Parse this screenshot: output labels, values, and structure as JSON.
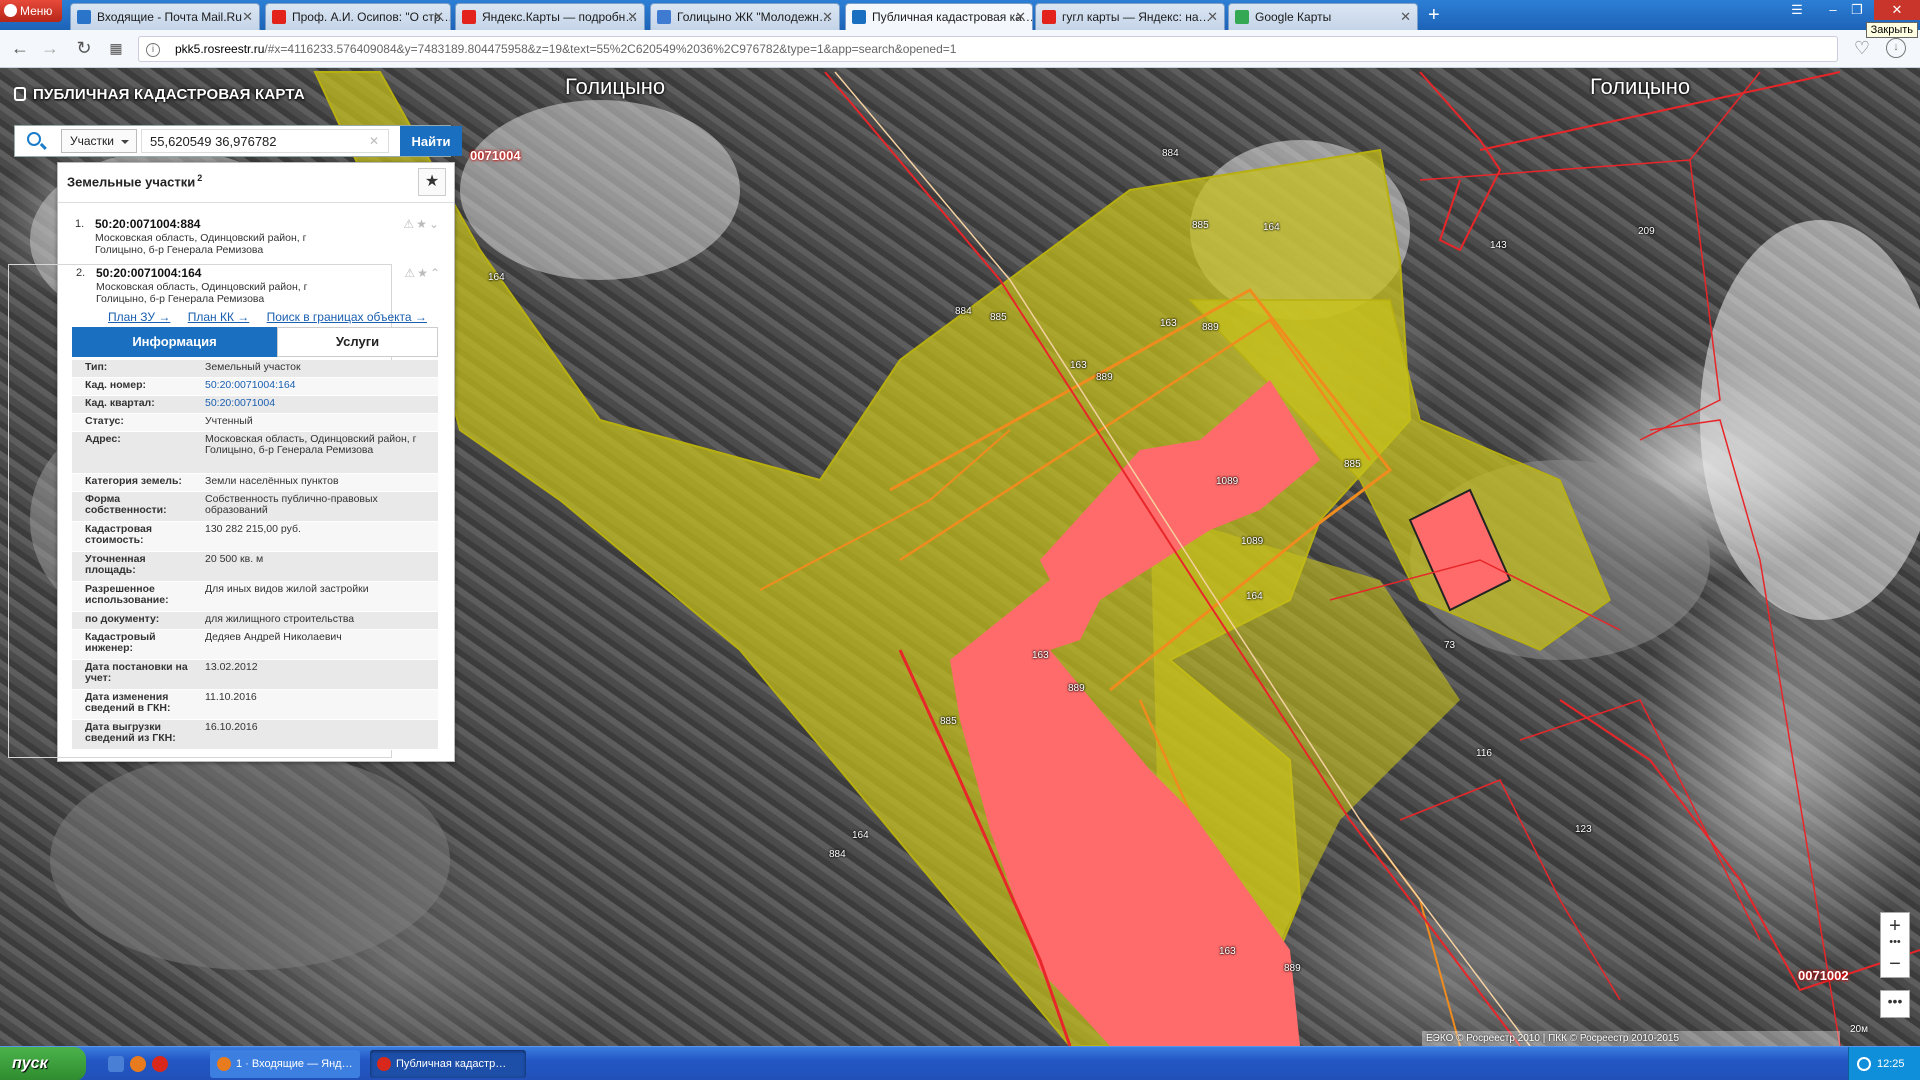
{
  "browser": {
    "menu_label": "Меню",
    "tabs": [
      {
        "label": "Входящие - Почта Mail.Ru",
        "color": "#2a75c9"
      },
      {
        "label": "Проф. А.И. Осипов: \"О стр…",
        "color": "#e3231b"
      },
      {
        "label": "Яндекс.Карты — подробн…",
        "color": "#e3231b"
      },
      {
        "label": "Голицыно ЖК \"Молодежн…",
        "color": "#3f7bd0"
      },
      {
        "label": "Публичная кадастровая ка…",
        "color": "#1a6fc0"
      },
      {
        "label": "гугл карты — Яндекс: на…",
        "color": "#e3231b"
      },
      {
        "label": "Google Карты",
        "color": "#34a853"
      }
    ],
    "active_tab_index": 4,
    "close_tooltip": "Закрыть",
    "url_domain": "pkk5.rosreestr.ru",
    "url_rest": "/#x=4116233.576409084&y=7483189.804475958&z=19&text=55%2C620549%2036%2C976782&type=1&app=search&opened=1"
  },
  "map": {
    "place_labels": [
      "Голицыно",
      "Голицыно"
    ],
    "quarter_labels": [
      "0071004",
      "0071002"
    ],
    "parcel_numbers": [
      "884",
      "885",
      "164",
      "884",
      "885",
      "164",
      "163",
      "889",
      "163",
      "889",
      "163",
      "889",
      "1089",
      "1089",
      "164",
      "885",
      "163",
      "889",
      "143",
      "209",
      "73",
      "116",
      "123",
      "885",
      "164",
      "884"
    ],
    "copyright": "ЕЭКО © Росреестр 2010 | ПКК © Росреестр 2010-2015",
    "scale": "20м",
    "colors": {
      "parcel_fill": "#c8c21a",
      "building_fill": "#ff6a6a",
      "boundary_red": "#e8262a",
      "boundary_orange": "#f08c1e"
    }
  },
  "app": {
    "title": "ПУБЛИЧНАЯ КАДАСТРОВАЯ КАРТА",
    "search": {
      "type": "Участки",
      "value": "55,620549 36,976782",
      "button": "Найти"
    },
    "panel_title": "Земельные участки",
    "panel_count": "2",
    "results": [
      {
        "num": "1.",
        "cad": "50:20:0071004:884",
        "addr": "Московская область, Одинцовский район, г Голицыно, б-р Генерала Ремизова"
      },
      {
        "num": "2.",
        "cad": "50:20:0071004:164",
        "addr": "Московская область, Одинцовский район, г Голицыно, б-р Генерала Ремизова"
      }
    ],
    "plan_links": [
      "План ЗУ →",
      "План КК →",
      "Поиск в границах объекта →"
    ],
    "tabs": {
      "info": "Информация",
      "services": "Услуги"
    },
    "info_rows": [
      {
        "k": "Тип:",
        "v": "Земельный участок"
      },
      {
        "k": "Кад. номер:",
        "v": "50:20:0071004:164"
      },
      {
        "k": "Кад. квартал:",
        "v": "50:20:0071004"
      },
      {
        "k": "Статус:",
        "v": "Учтенный"
      },
      {
        "k": "Адрес:",
        "v": "Московская область, Одинцовский район, г Голицыно, б-р Генерала Ремизова"
      },
      {
        "k": "Категория земель:",
        "v": "Земли населённых пунктов"
      },
      {
        "k": "Форма собственности:",
        "v": "Собственность публично-правовых образований"
      },
      {
        "k": "Кадастровая стоимость:",
        "v": "130 282 215,00 руб."
      },
      {
        "k": "Уточненная площадь:",
        "v": "20 500 кв. м"
      },
      {
        "k": "Разрешенное использование:",
        "v": "Для иных видов жилой застройки"
      },
      {
        "k": "по документу:",
        "v": "для жилищного строительства"
      },
      {
        "k": "Кадастровый инженер:",
        "v": "Дедяев Андрей Николаевич"
      },
      {
        "k": "Дата постановки на учет:",
        "v": "13.02.2012"
      },
      {
        "k": "Дата изменения сведений в ГКН:",
        "v": "11.10.2016"
      },
      {
        "k": "Дата выгрузки сведений из ГКН:",
        "v": "16.10.2016"
      }
    ]
  },
  "taskbar": {
    "start": "пуск",
    "tasks": [
      "1 · Входящие — Янд…",
      "Публичная кадастр…"
    ],
    "clock": "12:25"
  }
}
